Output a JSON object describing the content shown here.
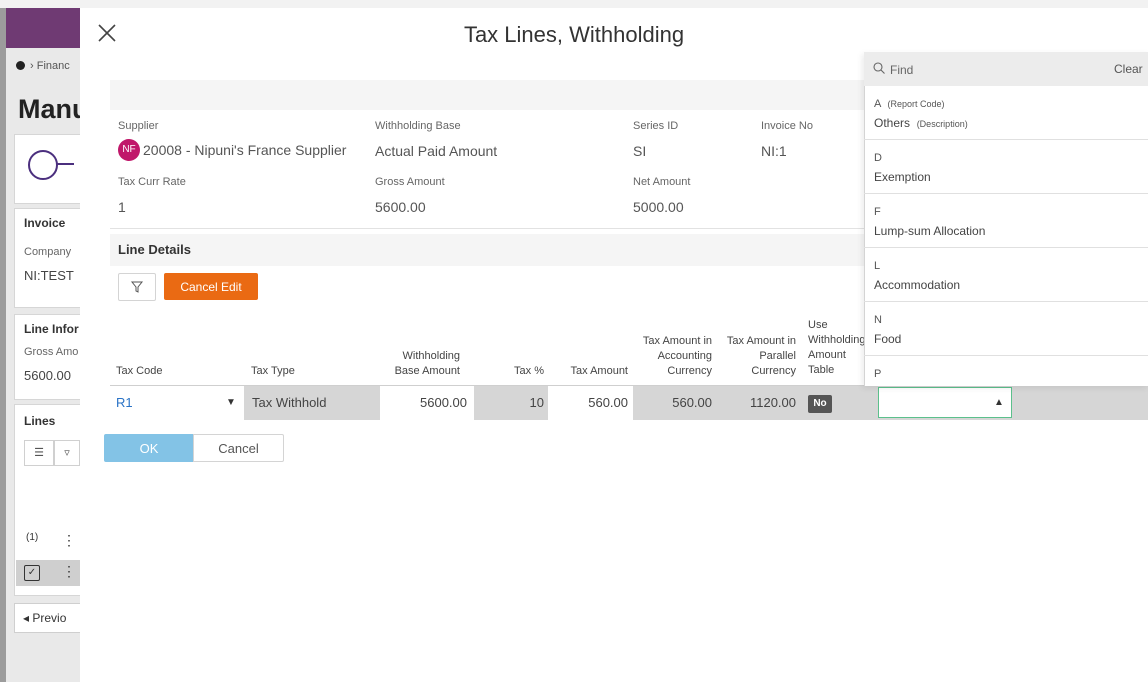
{
  "background": {
    "breadcrumb": "Financ",
    "page_title": "Manu",
    "invoice_heading": "Invoice",
    "company_label": "Company",
    "company_value": "NI:TEST",
    "line_info_heading": "Line Infor",
    "gross_label": "Gross Amo",
    "gross_value": "5600.00",
    "lines_heading": "Lines",
    "selection_count": "(1)",
    "previous_label": "◂ Previo"
  },
  "dialog": {
    "title": "Tax Lines, Withholding",
    "header": {
      "supplier_label": "Supplier",
      "supplier_initials": "NF",
      "supplier_value": "20008 - Nipuni's France Supplier",
      "withholding_base_label": "Withholding Base",
      "withholding_base_value": "Actual Paid Amount",
      "series_id_label": "Series ID",
      "series_id_value": "SI",
      "invoice_no_label": "Invoice No",
      "invoice_no_value": "NI:1",
      "tax_curr_rate_label": "Tax Curr Rate",
      "tax_curr_rate_value": "1",
      "gross_amount_label": "Gross Amount",
      "gross_amount_value": "5600.00",
      "net_amount_label": "Net Amount",
      "net_amount_value": "5000.00"
    },
    "line_details": {
      "title": "Line Details",
      "cancel_edit_label": "Cancel Edit",
      "columns": {
        "tax_code": "Tax Code",
        "tax_type": "Tax Type",
        "withholding_base": "Withholding\nBase Amount",
        "tax_pct": "Tax %",
        "tax_amount": "Tax Amount",
        "tax_amount_acc": "Tax Amount in\nAccounting\nCurrency",
        "tax_amount_par": "Tax Amount in\nParallel\nCurrency",
        "use_table": "Use\nWithholding\nAmount\nTable"
      },
      "row": {
        "tax_code": "R1",
        "tax_type": "Tax Withhold",
        "withholding_base": "5600.00",
        "tax_pct": "10",
        "tax_amount": "560.00",
        "tax_amount_acc": "560.00",
        "tax_amount_par": "1120.00",
        "use_table": "No",
        "report_code": ""
      }
    },
    "ok_label": "OK",
    "cancel_label": "Cancel"
  },
  "lookup": {
    "find_placeholder": "Find",
    "clear_label": "Clear",
    "code_tag": "(Report Code)",
    "desc_tag": "(Description)",
    "options": [
      {
        "code": "A",
        "description": "Others"
      },
      {
        "code": "D",
        "description": "Exemption"
      },
      {
        "code": "F",
        "description": "Lump-sum Allocation"
      },
      {
        "code": "L",
        "description": "Accommodation"
      },
      {
        "code": "N",
        "description": "Food"
      },
      {
        "code": "P",
        "description": ""
      }
    ]
  },
  "colors": {
    "brand_purple": "#6f3a73",
    "cancel_edit": "#ea6a13",
    "ok_button": "#83c3e6",
    "avatar": "#c0176a",
    "link_blue": "#2a73c6",
    "combo_focus": "#5cc08c"
  }
}
